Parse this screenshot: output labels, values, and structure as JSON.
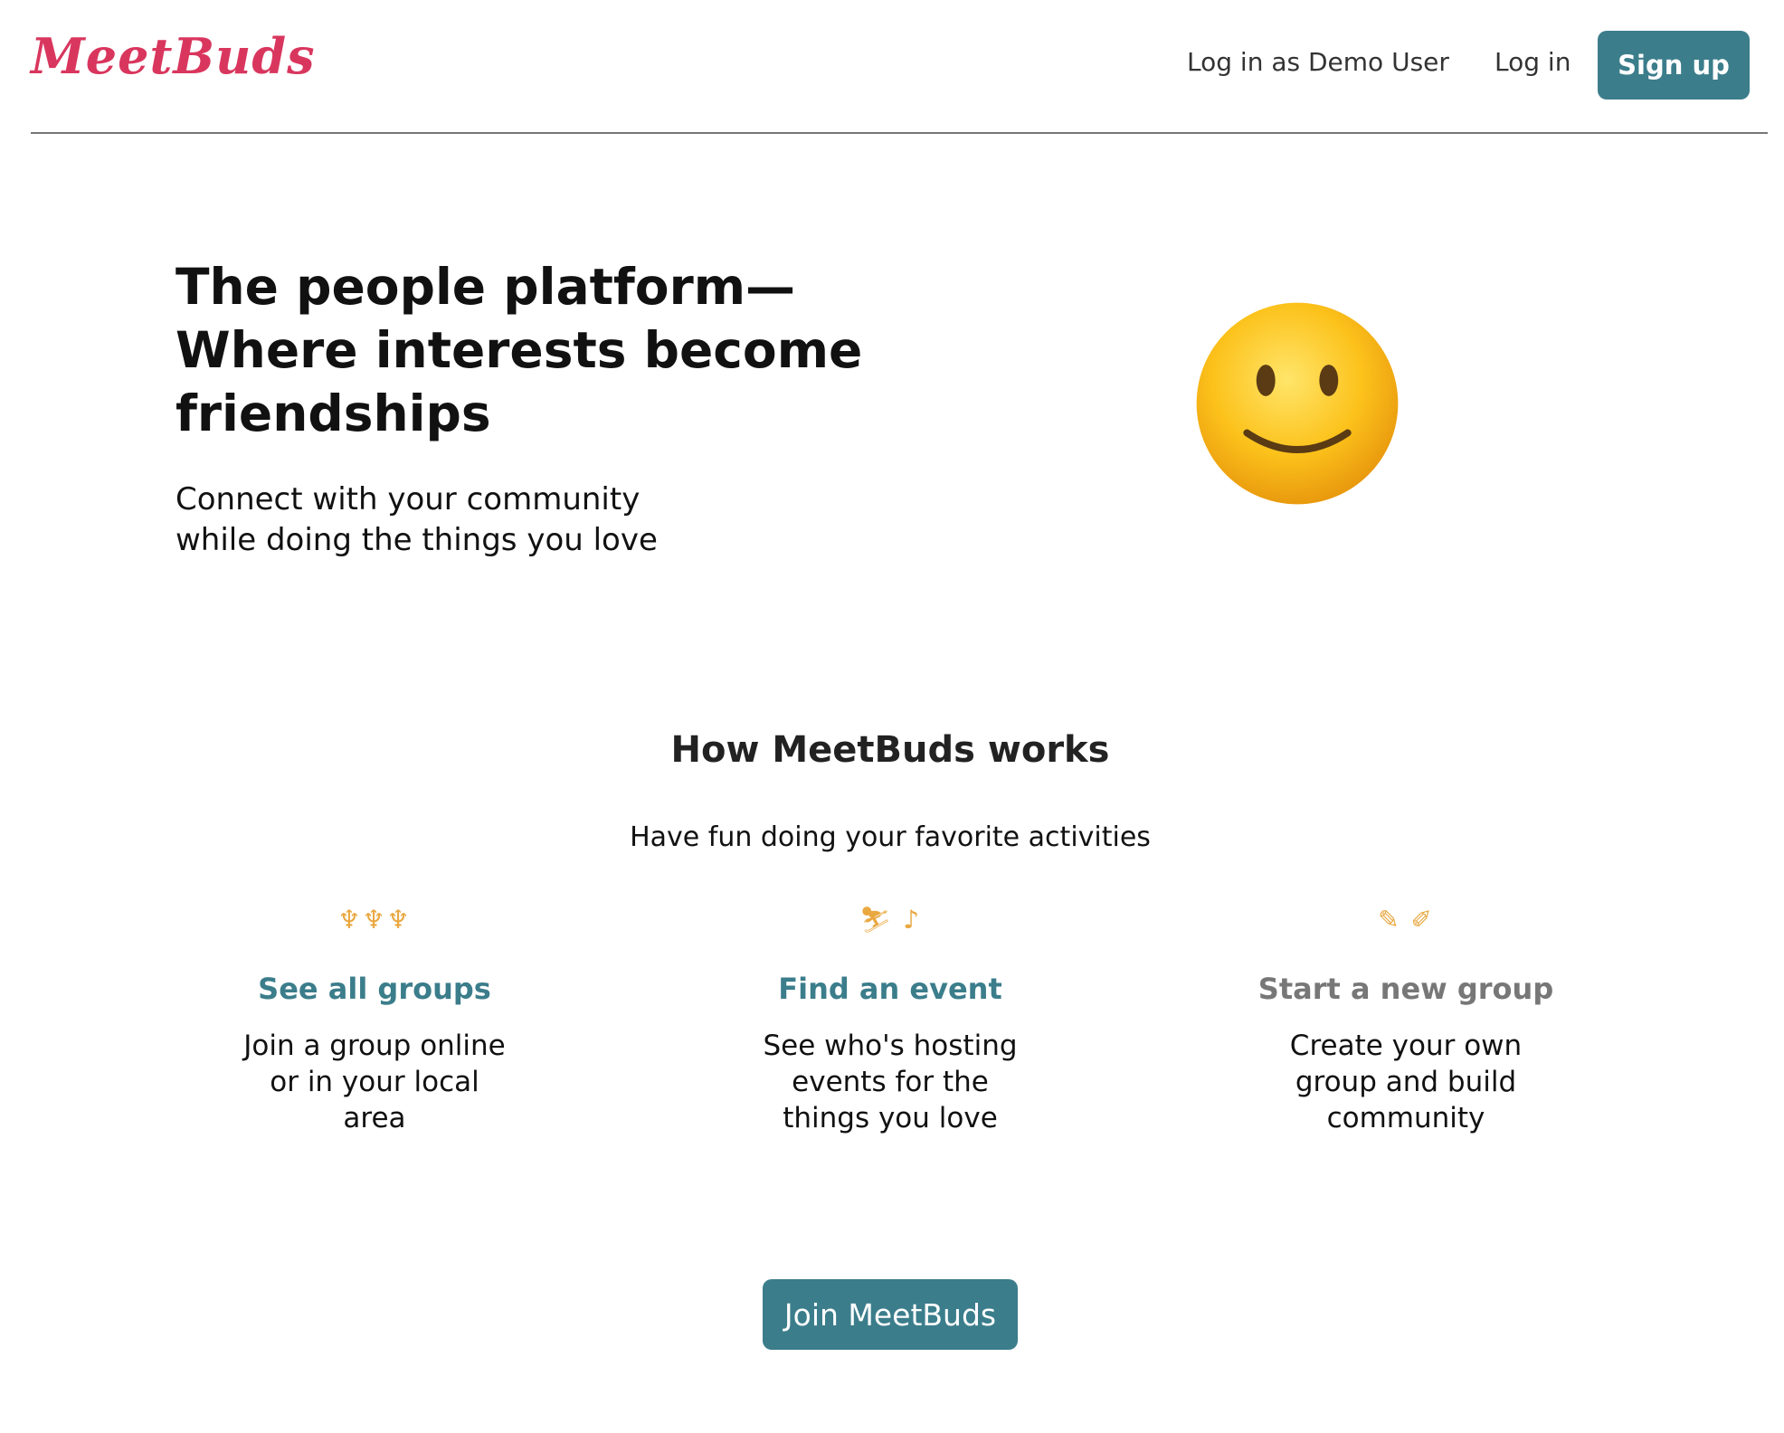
{
  "header": {
    "logo": "MeetBuds",
    "demo_login": "Log in as Demo User",
    "login": "Log in",
    "signup": "Sign up"
  },
  "hero": {
    "title": "The people platform— Where interests become friendships",
    "subtitle": "Connect with your community while doing the things you love",
    "image_icon": "smiley-face-emoji"
  },
  "how": {
    "title": "How MeetBuds works",
    "subtitle": "Have fun doing your favorite activities"
  },
  "features": [
    {
      "icon": "people-group-icon",
      "icon_glyph": "♆♆♆",
      "link": "See all groups",
      "desc": "Join a group online or in your local area"
    },
    {
      "icon": "skier-music-icon",
      "icon_glyph": "⛷ ♪",
      "link": "Find an event",
      "desc": "See who's hosting events for the things you love"
    },
    {
      "icon": "pencil-signature-icon",
      "icon_glyph": "✎ ✐",
      "link": "Start a new group",
      "desc": "Create your own group and build community"
    }
  ],
  "cta": {
    "label": "Join MeetBuds"
  },
  "colors": {
    "brand": "#d9365e",
    "accent": "#3b7d8b",
    "icon": "#e9a840",
    "muted": "#777777"
  }
}
